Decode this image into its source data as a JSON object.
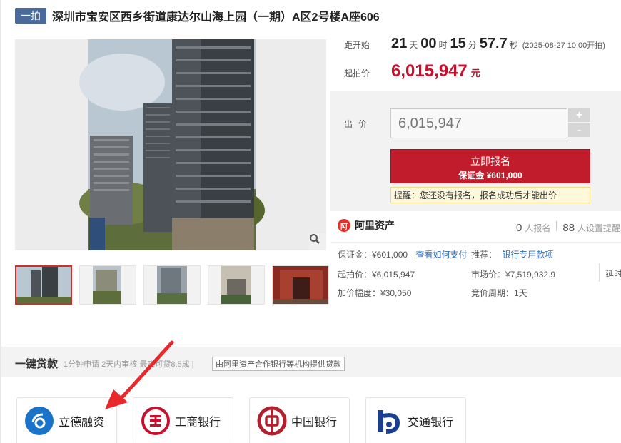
{
  "header": {
    "tag": "一拍",
    "title": "深圳市宝安区西乡街道康达尔山海上园（一期）A区2号楼A座606"
  },
  "countdown": {
    "label": "距开始",
    "days": "21",
    "days_unit": "天",
    "hours": "00",
    "hours_unit": "时",
    "minutes": "15",
    "minutes_unit": "分",
    "seconds": "57.7",
    "seconds_unit": "秒",
    "start_note": "(2025-08-27 10:00开拍)"
  },
  "start_price": {
    "label": "起拍价",
    "value": "6,015,947",
    "unit": "元"
  },
  "bid": {
    "label": "出价",
    "value": "6,015,947",
    "plus": "+",
    "minus": "-",
    "register_label": "立即报名",
    "deposit_label": "保证金 ¥601,000",
    "reminder": "提醒：您还没有报名，报名成功后才能出价"
  },
  "ali": {
    "logo_text": "阿里资产",
    "logo_mark": "阿",
    "registered_count": "0",
    "registered_label": "人报名",
    "reminder_count": "88",
    "reminder_label": "人设置提醒",
    "deposit": "保证金：¥601,000",
    "deposit_link": "查看如何支付",
    "recommend": "推荐：",
    "recommend_link": "银行专用款项",
    "start_price": "起拍价：¥6,015,947",
    "market_price": "市场价：¥7,519,932.9",
    "extend": "延时",
    "increment": "加价幅度：¥30,050",
    "cycle": "竞价周期：1天"
  },
  "loan": {
    "title": "一键贷款",
    "subtitle": "1分钟申请 2天内审核 最高可贷8.5成 |",
    "provider": "由阿里资产合作银行等机构提供贷款",
    "banks": [
      {
        "name": "立德融资",
        "icon": "lide-icon",
        "color": "#1a73c9"
      },
      {
        "name": "工商银行",
        "icon": "icbc-icon",
        "color": "#c8102e"
      },
      {
        "name": "中国银行",
        "icon": "boc-icon",
        "color": "#b2202e"
      },
      {
        "name": "交通银行",
        "icon": "bocom-icon",
        "color": "#1b3f8f"
      }
    ]
  },
  "colors": {
    "accent": "#c8102e",
    "link": "#2a6ebb",
    "tag_bg": "#4a6b9a"
  }
}
